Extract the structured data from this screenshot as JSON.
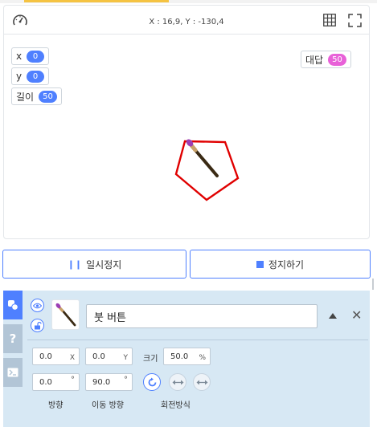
{
  "stage": {
    "coord_readout": "X : 16,9, Y : -130,4",
    "variables": [
      {
        "label": "x",
        "value": "0"
      },
      {
        "label": "y",
        "value": "0"
      },
      {
        "label": "길이",
        "value": "50"
      }
    ],
    "answer": {
      "label": "대답",
      "value": "50"
    },
    "icons": [
      "speed-gauge-icon",
      "grid-icon",
      "fullscreen-icon"
    ]
  },
  "controls": {
    "pause_label": "일시정지",
    "stop_label": "정지하기"
  },
  "object_panel": {
    "name": "붓 버튼",
    "x": "0.0",
    "x_unit": "X",
    "y": "0.0",
    "y_unit": "Y",
    "size_label": "크기",
    "size": "50.0",
    "size_unit": "%",
    "direction": "0.0",
    "move_direction": "90.0",
    "degree_symbol": "°",
    "direction_label": "방향",
    "move_direction_label": "이동 방향",
    "rotation_label": "회전방식",
    "side_tab_help": "?"
  },
  "colors": {
    "accent": "#4f80ff",
    "pen_stroke": "#e00000",
    "answer_pill": "#e861d8",
    "panel_bg": "#d7e8f4"
  }
}
